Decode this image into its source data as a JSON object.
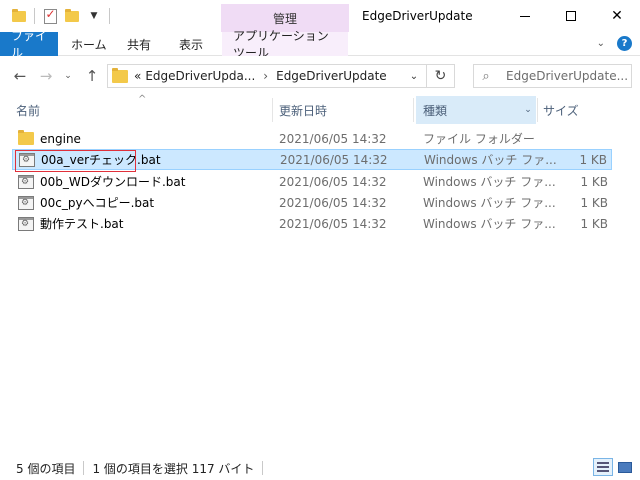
{
  "window": {
    "title": "EdgeDriverUpdate",
    "context_tab_group": "管理"
  },
  "ribbon": {
    "tabs": [
      "ファイル",
      "ホーム",
      "共有",
      "表示",
      "アプリケーション ツール"
    ]
  },
  "nav": {
    "breadcrumb_prefix": "«",
    "crumbs": [
      "EdgeDriverUpda...",
      "EdgeDriverUpdate"
    ],
    "search_placeholder": "EdgeDriverUpdate..."
  },
  "columns": {
    "name": "名前",
    "date": "更新日時",
    "type": "種類",
    "size": "サイズ"
  },
  "files": [
    {
      "name": "engine",
      "date": "2021/06/05 14:32",
      "type": "ファイル フォルダー",
      "size": "",
      "kind": "folder-icon"
    },
    {
      "name": "00a_verチェック.bat",
      "date": "2021/06/05 14:32",
      "type": "Windows バッチ ファ...",
      "size": "1 KB",
      "kind": "batch-file-icon",
      "selected": true
    },
    {
      "name": "00b_WDダウンロード.bat",
      "date": "2021/06/05 14:32",
      "type": "Windows バッチ ファ...",
      "size": "1 KB",
      "kind": "batch-file-icon"
    },
    {
      "name": "00c_pyへコピー.bat",
      "date": "2021/06/05 14:32",
      "type": "Windows バッチ ファ...",
      "size": "1 KB",
      "kind": "batch-file-icon"
    },
    {
      "name": "動作テスト.bat",
      "date": "2021/06/05 14:32",
      "type": "Windows バッチ ファ...",
      "size": "1 KB",
      "kind": "batch-file-icon"
    }
  ],
  "status": {
    "item_count": "5 個の項目",
    "selection": "1 個の項目を選択  117 バイト"
  },
  "colors": {
    "file_tab": "#1979ca",
    "context_tab": "#f0dcf5",
    "selection": "#cce8ff",
    "highlight_border": "#e0303a"
  }
}
